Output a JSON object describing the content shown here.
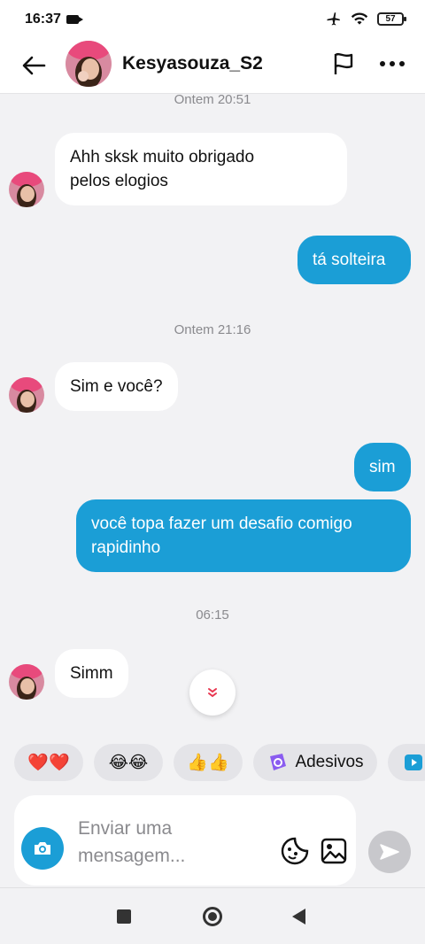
{
  "status": {
    "time": "16:37",
    "battery": "57"
  },
  "header": {
    "username": "Kesyasouza_S2"
  },
  "messages": {
    "ts1": "Ontem 20:51",
    "m1": "Ahh sksk muito obrigado",
    "m1b": "pelos elogios",
    "m2": "tá solteira",
    "ts2": "Ontem 21:16",
    "m3": "Sim e você?",
    "m4": "sim",
    "m5": "você topa fazer um desafio comigo",
    "m5b": "rapidinho",
    "ts3": "06:15",
    "m6": "Simm"
  },
  "quick": {
    "hearts": "❤️❤️",
    "laugh": "😂😂",
    "thumbs": "👍👍",
    "stickers": "Adesivos"
  },
  "input": {
    "placeholder_line1": "Enviar uma",
    "placeholder_line2": "mensagem..."
  },
  "colors": {
    "accent": "#1b9ed6",
    "background": "#f2f2f4"
  },
  "icons": [
    "back-arrow-icon",
    "flag-icon",
    "more-icon",
    "camera-icon",
    "sticker-icon",
    "gallery-icon",
    "send-icon",
    "chevron-down-icon"
  ]
}
